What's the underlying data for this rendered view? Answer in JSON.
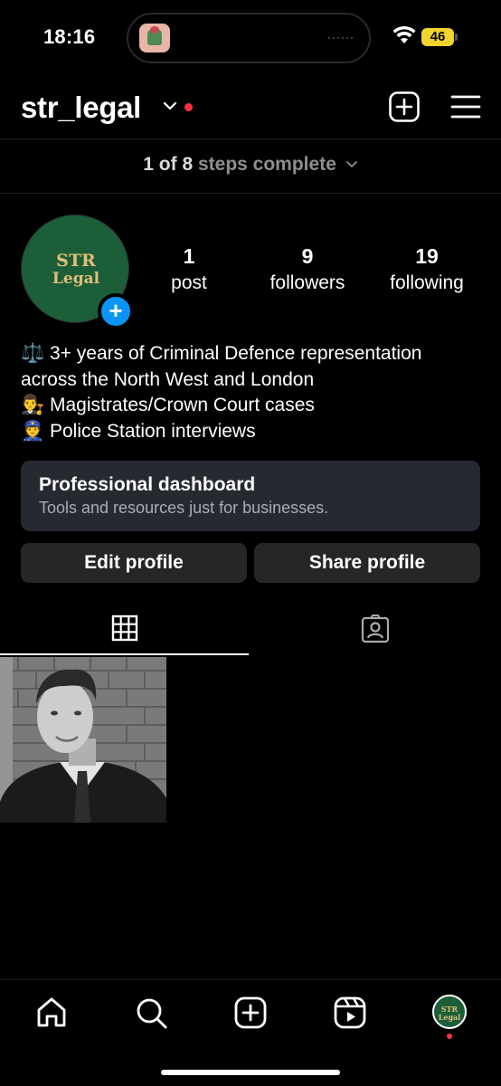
{
  "status_bar": {
    "time": "18:16",
    "battery": "46",
    "island_dots": "······"
  },
  "header": {
    "username": "str_legal",
    "icons": [
      "chevron-down-icon",
      "notification-dot",
      "new-post-icon",
      "menu-icon"
    ]
  },
  "steps": {
    "count": "1 of 8",
    "text": "steps complete"
  },
  "profile": {
    "avatar_line1": "STR",
    "avatar_line2": "Legal",
    "stats": [
      {
        "num": "1",
        "label": "post"
      },
      {
        "num": "9",
        "label": "followers"
      },
      {
        "num": "19",
        "label": "following"
      }
    ],
    "bio": [
      "⚖️ 3+ years of Criminal Defence representation",
      "across the North West and London",
      "👨‍⚖️ Magistrates/Crown Court cases",
      "👮 Police Station interviews"
    ]
  },
  "dashboard": {
    "title": "Professional dashboard",
    "subtitle": "Tools and resources just for businesses."
  },
  "buttons": {
    "edit": "Edit profile",
    "share": "Share profile"
  },
  "tabs": [
    "grid-icon",
    "tagged-icon"
  ],
  "nav": {
    "avatar_text_1": "STR",
    "avatar_text_2": "Legal"
  },
  "colors": {
    "accent_blue": "#0a95f6",
    "notification_red": "#ff3040",
    "avatar_green": "#1c5e38",
    "avatar_gold": "#e1bf78",
    "battery_yellow": "#f2d42e"
  }
}
